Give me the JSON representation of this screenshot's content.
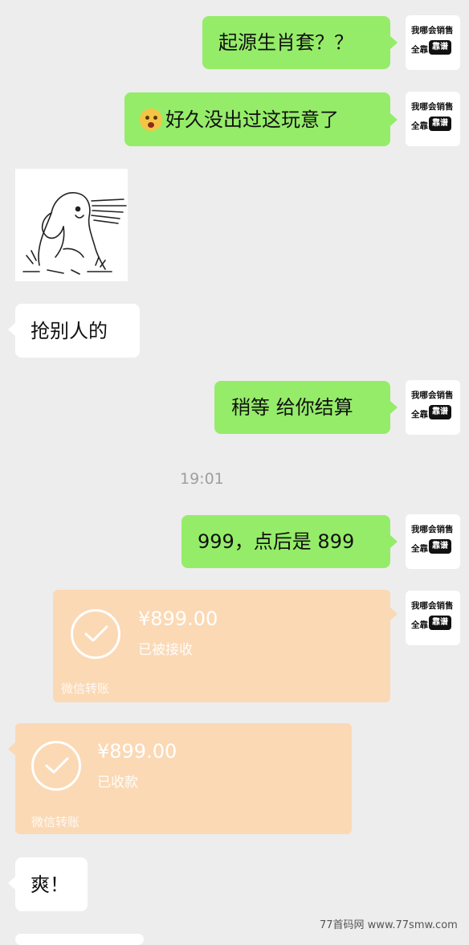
{
  "messages": {
    "m1": "起源生肖套？？",
    "m2": "好久没出过这玩意了",
    "m3": "抢别人的",
    "m4": "稍等 给你结算",
    "m5": "999，点后是 899",
    "m6": "爽！"
  },
  "timestamp": "19:01",
  "seller_avatar": {
    "line1": "我哪会销售",
    "line2a": "全靠",
    "line2b": "靠谱"
  },
  "transfers": {
    "sent": {
      "amount": "¥899.00",
      "status": "已被接收",
      "label": "微信转账"
    },
    "received": {
      "amount": "¥899.00",
      "status": "已收款",
      "label": "微信转账"
    }
  },
  "emoji_icon": "astonished-face-icon",
  "watermark": "77首码网 www.77smw.com",
  "colors": {
    "background": "#EDEDED",
    "green_bubble": "#95EC69",
    "white_bubble": "#FFFFFF",
    "transfer_card": "#FBD9B5",
    "timestamp": "#9E9E9E"
  }
}
